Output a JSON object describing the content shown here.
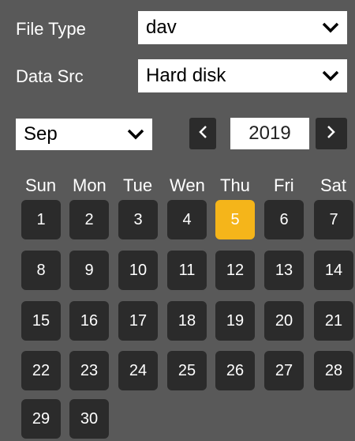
{
  "filter": {
    "file_type_label": "File Type",
    "file_type_value": "dav",
    "data_src_label": "Data Src",
    "data_src_value": "Hard disk"
  },
  "calendar": {
    "month_value": "Sep",
    "year_value": "2019",
    "prev_icon": "chevron-left-icon",
    "next_icon": "chevron-right-icon",
    "weekdays": [
      "Sun",
      "Mon",
      "Tue",
      "Wen",
      "Thu",
      "Fri",
      "Sat"
    ],
    "days": [
      "1",
      "2",
      "3",
      "4",
      "5",
      "6",
      "7",
      "8",
      "9",
      "10",
      "11",
      "12",
      "13",
      "14",
      "15",
      "16",
      "17",
      "18",
      "19",
      "20",
      "21",
      "22",
      "23",
      "24",
      "25",
      "26",
      "27",
      "28",
      "29",
      "30"
    ],
    "selected_day": "5",
    "colors": {
      "background": "#595959",
      "day_cell": "#2b2b2b",
      "selected": "#f5b51a"
    }
  }
}
